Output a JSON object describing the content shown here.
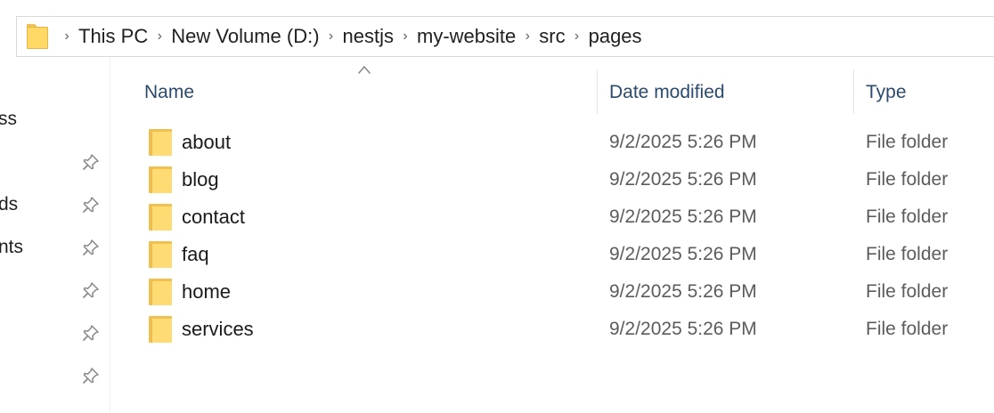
{
  "address_bar": {
    "folder_icon": "folder-icon",
    "separator_icon": "chevron-right-icon",
    "crumbs": [
      "This PC",
      "New Volume (D:)",
      "nestjs",
      "my-website",
      "src",
      "pages"
    ]
  },
  "nav_pane": {
    "items": [
      "ss",
      "ds",
      "nts"
    ],
    "pin_icon": "pin-icon"
  },
  "columns": {
    "name": "Name",
    "date_modified": "Date modified",
    "type": "Type",
    "sort_icon": "sort-ascending-icon"
  },
  "files": [
    {
      "name": "about",
      "date": "9/2/2025 5:26 PM",
      "type": "File folder"
    },
    {
      "name": "blog",
      "date": "9/2/2025 5:26 PM",
      "type": "File folder"
    },
    {
      "name": "contact",
      "date": "9/2/2025 5:26 PM",
      "type": "File folder"
    },
    {
      "name": "faq",
      "date": "9/2/2025 5:26 PM",
      "type": "File folder"
    },
    {
      "name": "home",
      "date": "9/2/2025 5:26 PM",
      "type": "File folder"
    },
    {
      "name": "services",
      "date": "9/2/2025 5:26 PM",
      "type": "File folder"
    }
  ],
  "colors": {
    "header_text": "#2b4a6f",
    "folder_yellow": "#ffdb73"
  }
}
